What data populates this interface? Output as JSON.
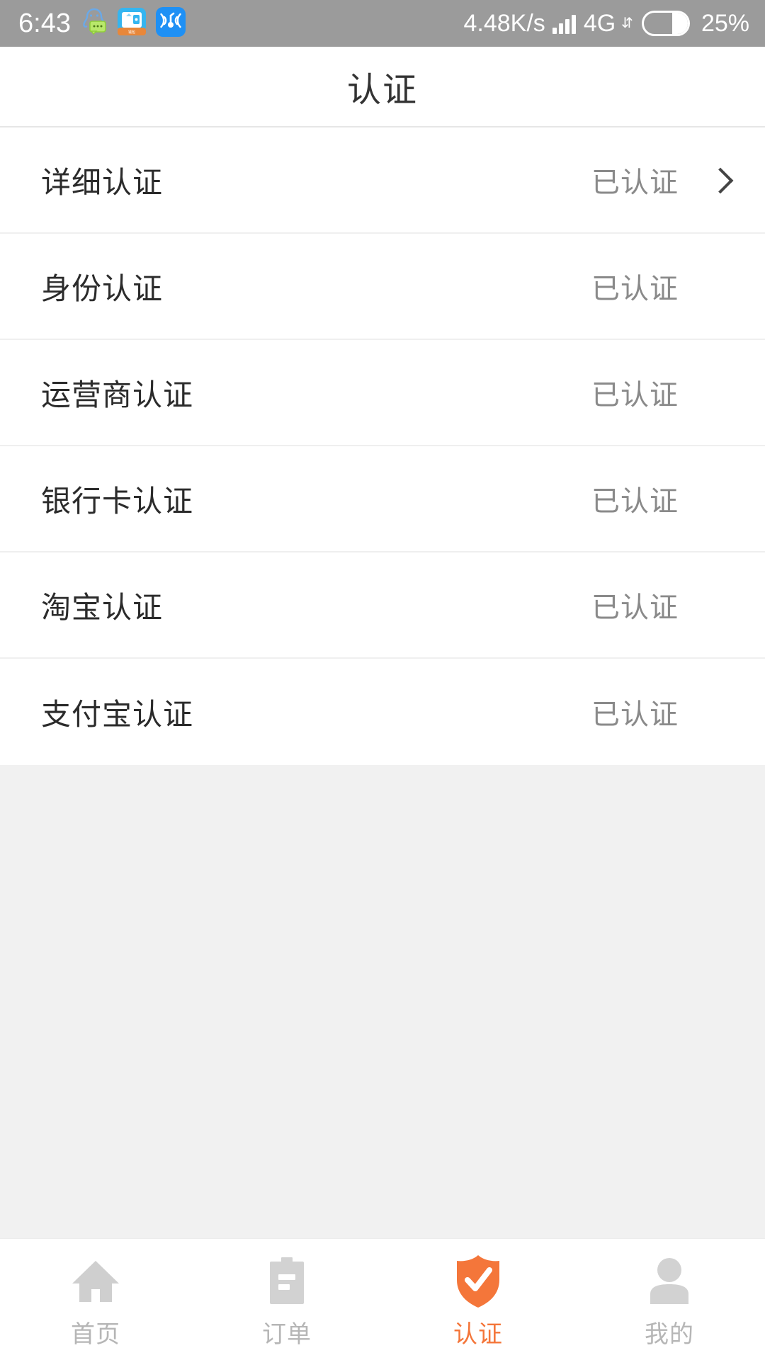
{
  "status_bar": {
    "time": "6:43",
    "net_speed": "4.48K/s",
    "network_type": "4G",
    "battery_percent": "25%",
    "battery_level": 25,
    "background_color": "#9b9b9b",
    "icons": [
      {
        "name": "qq-chat-icon",
        "label": "QQ"
      },
      {
        "name": "wallet-app-icon",
        "label": "钱包"
      },
      {
        "name": "wifi-signal-app-icon",
        "label": "WiFi"
      }
    ]
  },
  "header": {
    "title": "认证"
  },
  "list": {
    "status_color": "#8a8a8a",
    "items": [
      {
        "label": "详细认证",
        "status": "已认证",
        "has_chevron": true
      },
      {
        "label": "身份认证",
        "status": "已认证",
        "has_chevron": false
      },
      {
        "label": "运营商认证",
        "status": "已认证",
        "has_chevron": false
      },
      {
        "label": "银行卡认证",
        "status": "已认证",
        "has_chevron": false
      },
      {
        "label": "淘宝认证",
        "status": "已认证",
        "has_chevron": false
      },
      {
        "label": "支付宝认证",
        "status": "已认证",
        "has_chevron": false
      }
    ]
  },
  "bottom_nav": {
    "active_color": "#f4763a",
    "inactive_color": "#b6b6b6",
    "items": [
      {
        "label": "首页",
        "icon": "home-icon",
        "active": false
      },
      {
        "label": "订单",
        "icon": "clipboard-icon",
        "active": false
      },
      {
        "label": "认证",
        "icon": "shield-check-icon",
        "active": true
      },
      {
        "label": "我的",
        "icon": "person-icon",
        "active": false
      }
    ]
  }
}
